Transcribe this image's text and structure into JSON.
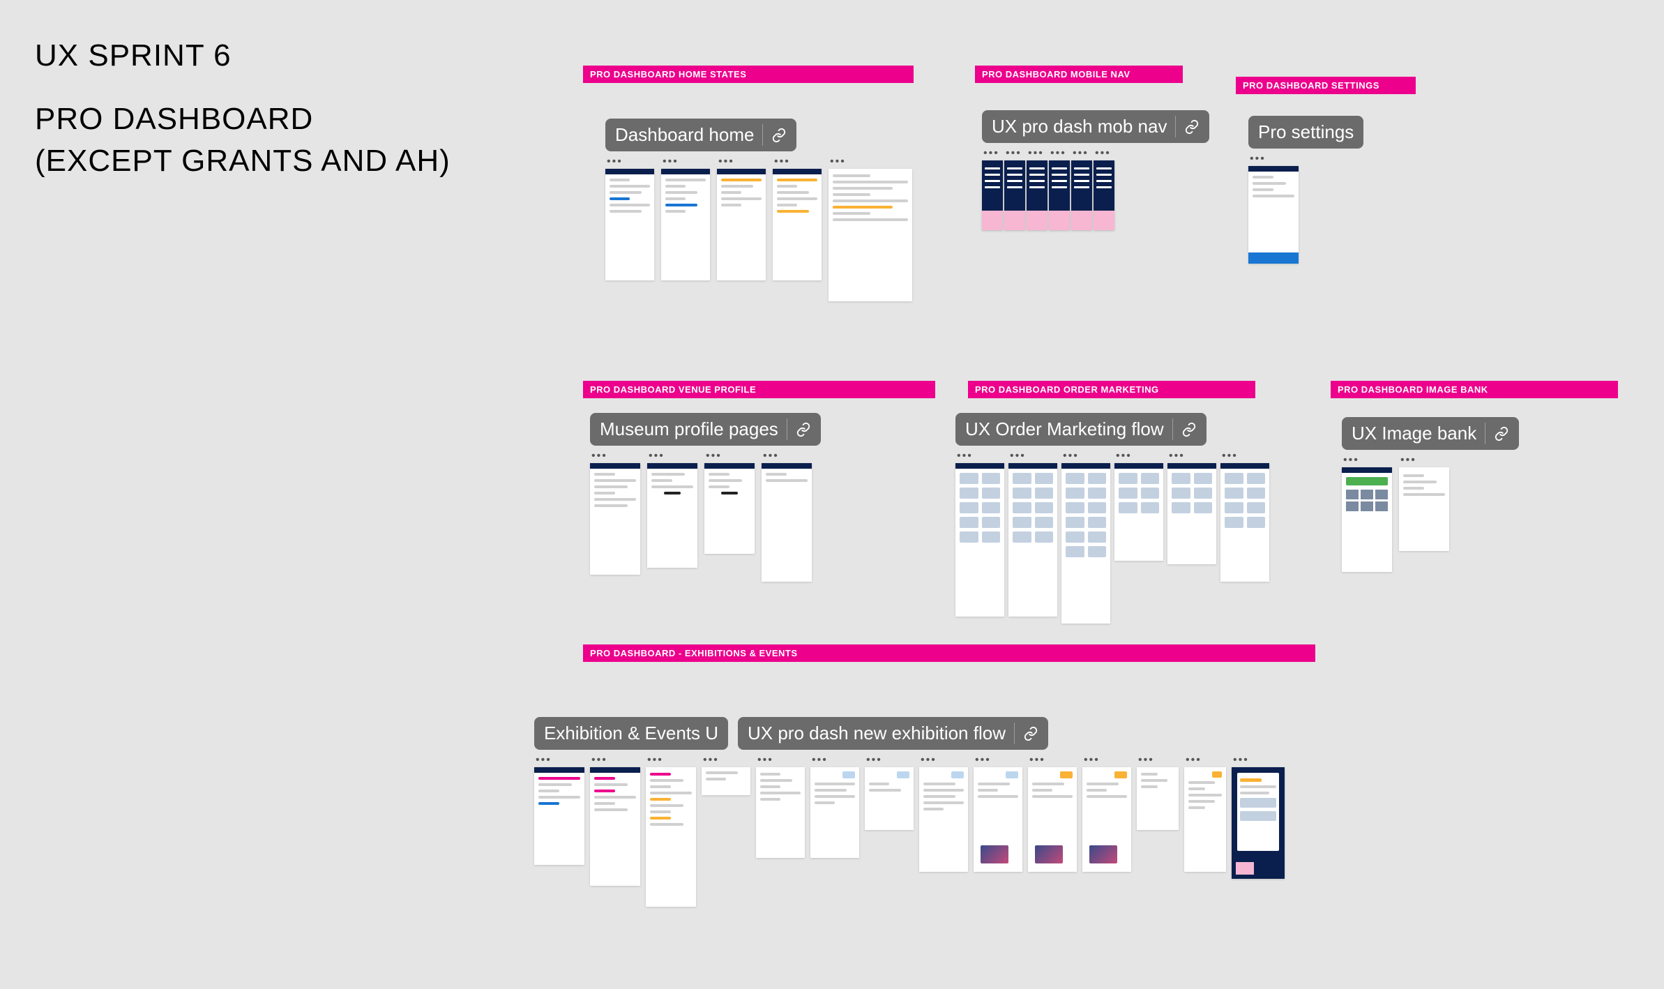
{
  "title": {
    "line1": "UX SPRINT 6",
    "line2": "PRO DASHBOARD",
    "line3": "(EXCEPT GRANTS AND AH)"
  },
  "sections": {
    "homeStates": {
      "bar": "PRO DASHBOARD HOME STATES",
      "pill": "Dashboard home"
    },
    "mobileNav": {
      "bar": "PRO DASHBOARD MOBILE NAV",
      "pill": "UX pro dash mob nav"
    },
    "settings": {
      "bar": "PRO DASHBOARD SETTINGS",
      "pill": "Pro settings"
    },
    "venue": {
      "bar": "PRO DASHBOARD VENUE PROFILE",
      "pill": "Museum profile pages"
    },
    "orderMkt": {
      "bar": "PRO DASHBOARD ORDER MARKETING",
      "pill": "UX Order Marketing flow"
    },
    "imageBank": {
      "bar": "PRO DASHBOARD IMAGE BANK",
      "pill": "UX Image bank"
    },
    "exhibitions": {
      "bar": "PRO DASHBOARD - EXHIBITIONS & EVENTS",
      "pill1": "Exhibition & Events U",
      "pill2": "UX pro dash new exhibition flow"
    }
  },
  "ellipsis": "•••"
}
